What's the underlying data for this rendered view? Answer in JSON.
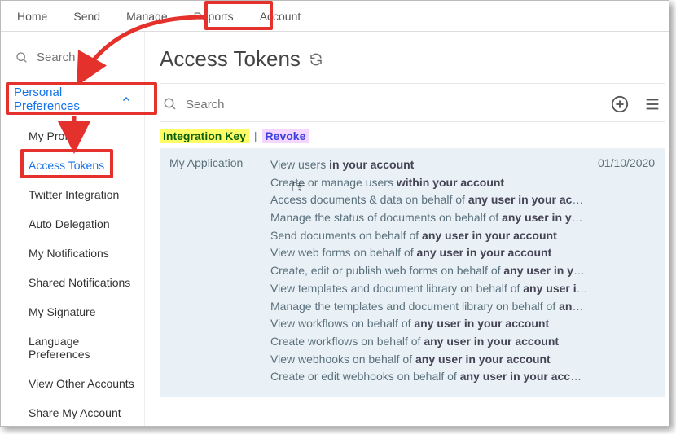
{
  "nav": {
    "items": [
      "Home",
      "Send",
      "Manage",
      "Reports",
      "Account"
    ]
  },
  "sidebar": {
    "search_placeholder": "Search",
    "section_label": "Personal Preferences",
    "items": [
      "My Profile",
      "Access Tokens",
      "Twitter Integration",
      "Auto Delegation",
      "My Notifications",
      "Shared Notifications",
      "My Signature",
      "Language Preferences",
      "View Other Accounts",
      "Share My Account"
    ],
    "active_index": 1
  },
  "main": {
    "title": "Access Tokens",
    "search_placeholder": "Search",
    "badges": {
      "key": "Integration Key",
      "sep": "|",
      "revoke": "Revoke"
    },
    "token": {
      "app_name": "My Application",
      "date": "01/10/2020",
      "permissions": [
        {
          "pre": "View users ",
          "bold": "in your account",
          "post": ""
        },
        {
          "pre": "Create or manage users ",
          "bold": "within your account",
          "post": ""
        },
        {
          "pre": "Access documents & data on behalf of ",
          "bold": "any user in your account",
          "post": ""
        },
        {
          "pre": "Manage the status of documents on behalf of ",
          "bold": "any user in your acc",
          "post": "..."
        },
        {
          "pre": "Send documents on behalf of ",
          "bold": "any user in your account",
          "post": ""
        },
        {
          "pre": "View web forms on behalf of ",
          "bold": "any user in your account",
          "post": ""
        },
        {
          "pre": "Create, edit or publish web forms on behalf of ",
          "bold": "any user in your acc",
          "post": "..."
        },
        {
          "pre": "View templates and document library on behalf of ",
          "bold": "any user in your",
          "post": "..."
        },
        {
          "pre": "Manage the templates and document library on behalf of ",
          "bold": "any user",
          "post": " ..."
        },
        {
          "pre": "View workflows on behalf of ",
          "bold": "any user in your account",
          "post": ""
        },
        {
          "pre": "Create workflows on behalf of ",
          "bold": "any user in your account",
          "post": ""
        },
        {
          "pre": "View webhooks on behalf of ",
          "bold": "any user in your account",
          "post": ""
        },
        {
          "pre": "Create or edit webhooks on behalf of ",
          "bold": "any user in your account",
          "post": ""
        }
      ]
    }
  }
}
